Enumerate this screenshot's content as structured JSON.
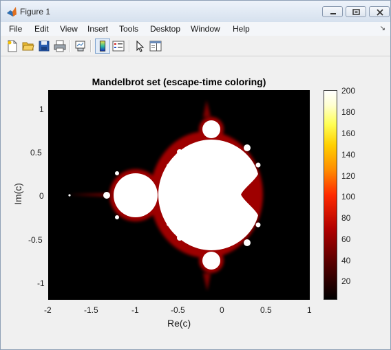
{
  "window": {
    "title": "Figure 1"
  },
  "menu": {
    "items": [
      "File",
      "Edit",
      "View",
      "Insert",
      "Tools",
      "Desktop",
      "Window",
      "Help"
    ],
    "dock_arrow": "↘"
  },
  "toolbar": {
    "buttons": [
      "new-figure",
      "open-file",
      "save",
      "print",
      "link-plot",
      "colorbar",
      "legend",
      "edit-plot",
      "property-editor"
    ]
  },
  "plot": {
    "title": "Mandelbrot set (escape-time coloring)",
    "xlabel": "Re(c)",
    "ylabel": "Im(c)",
    "xticks": [
      "-2",
      "-1.5",
      "-1",
      "-0.5",
      "0",
      "0.5",
      "1"
    ],
    "yticks": [
      "1",
      "0.5",
      "0",
      "-0.5",
      "-1"
    ],
    "xlim": [
      -2,
      1
    ],
    "ylim": [
      -1.2,
      1.2
    ],
    "colormap": "hot",
    "colors": {
      "background": "#000000",
      "set": "#ffffff"
    }
  },
  "colorbar": {
    "ticks": [
      "200",
      "180",
      "160",
      "140",
      "120",
      "100",
      "80",
      "60",
      "40",
      "20"
    ],
    "range": [
      1,
      200
    ]
  }
}
